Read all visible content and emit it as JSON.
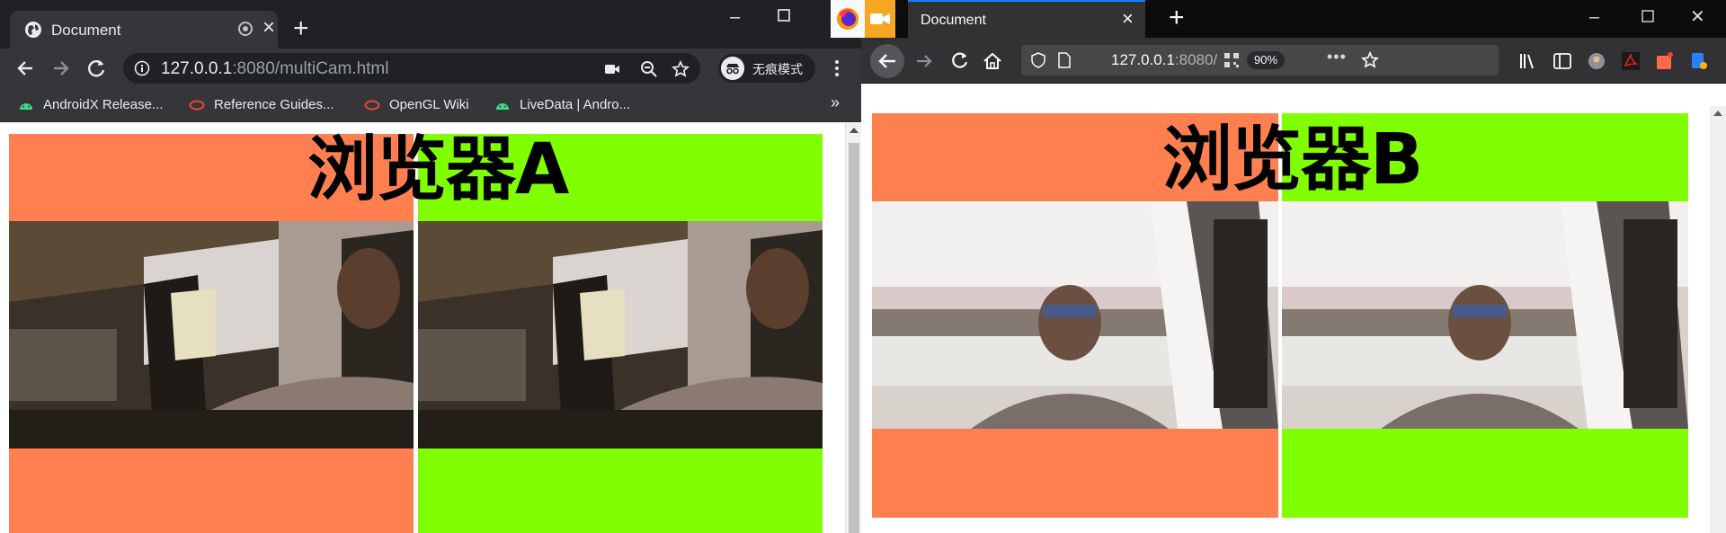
{
  "chrome": {
    "tab_title": "Document",
    "url_host": "127.0.0.1",
    "url_rest": ":8080/multiCam.html",
    "incognito_label": "无痕模式",
    "bookmarks": [
      {
        "label": "AndroidX Release...",
        "icon": "android-icon"
      },
      {
        "label": "Reference Guides...",
        "icon": "oracle-icon"
      },
      {
        "label": "OpenGL Wiki",
        "icon": "oracle-icon"
      },
      {
        "label": "LiveData  |  Andro...",
        "icon": "android-icon"
      }
    ],
    "page_heading": "浏览器A",
    "colors": {
      "left_panel": "#ff7f50",
      "right_panel": "#80ff00"
    }
  },
  "firefox": {
    "tab_title": "Document",
    "url_host": "127.0.0.1",
    "url_rest": ":8080/",
    "zoom": "90%",
    "page_heading": "浏览器B",
    "colors": {
      "left_panel": "#ff7f50",
      "right_panel": "#80ff00"
    }
  },
  "icons": {
    "tab_favicon": "globe-icon",
    "recording": "recording-indicator-icon",
    "camera": "camera-icon",
    "zoom": "zoom-icon",
    "star": "bookmark-star-icon",
    "firefox": "firefox-logo-icon"
  }
}
